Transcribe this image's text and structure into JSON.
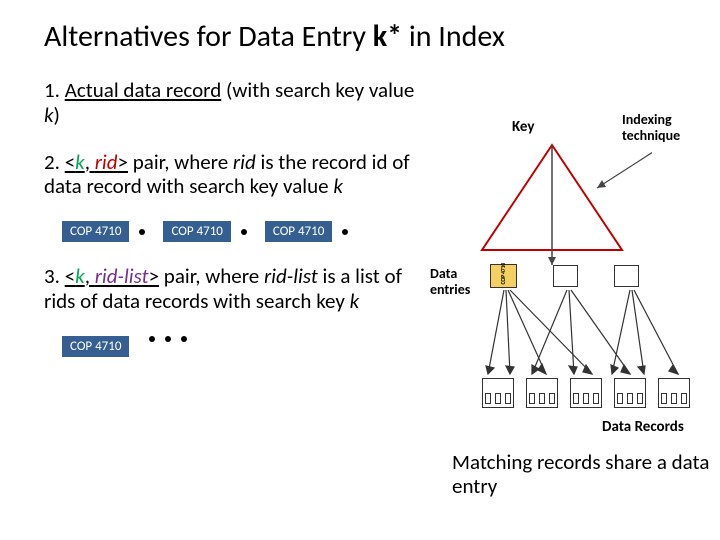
{
  "title": {
    "pre": "Alternatives for Data Entry ",
    "kstar": "k*",
    "post": " in Index"
  },
  "items": {
    "one": {
      "num": "1. ",
      "u": "Actual data record",
      "rest1": " (with search key value ",
      "k": "k",
      "rest2": ")"
    },
    "two": {
      "num": "2. ",
      "open": "<",
      "k": "k",
      "comma": ", ",
      "rid": "rid",
      "close": ">",
      "rest1": " pair, where ",
      "rid2": "rid",
      "rest2": " is the record id of data record with search key value ",
      "k2": "k"
    },
    "three": {
      "num": "3. ",
      "open": "<",
      "k": "k",
      "comma": ", ",
      "ridlist": "rid-list",
      "close": ">",
      "rest1": " pair, where ",
      "ridlist2": "rid-list",
      "rest2": " is a list of rids of data records with search key ",
      "k2": "k"
    }
  },
  "box_label": "COP 4710",
  "diagram": {
    "key_label": "Key",
    "technique_label": "Indexing technique",
    "entries_label": "Data entries",
    "records_label": "Data Records",
    "entry_vertical_label": "COP 4710"
  },
  "caption": "Matching records share a data entry"
}
